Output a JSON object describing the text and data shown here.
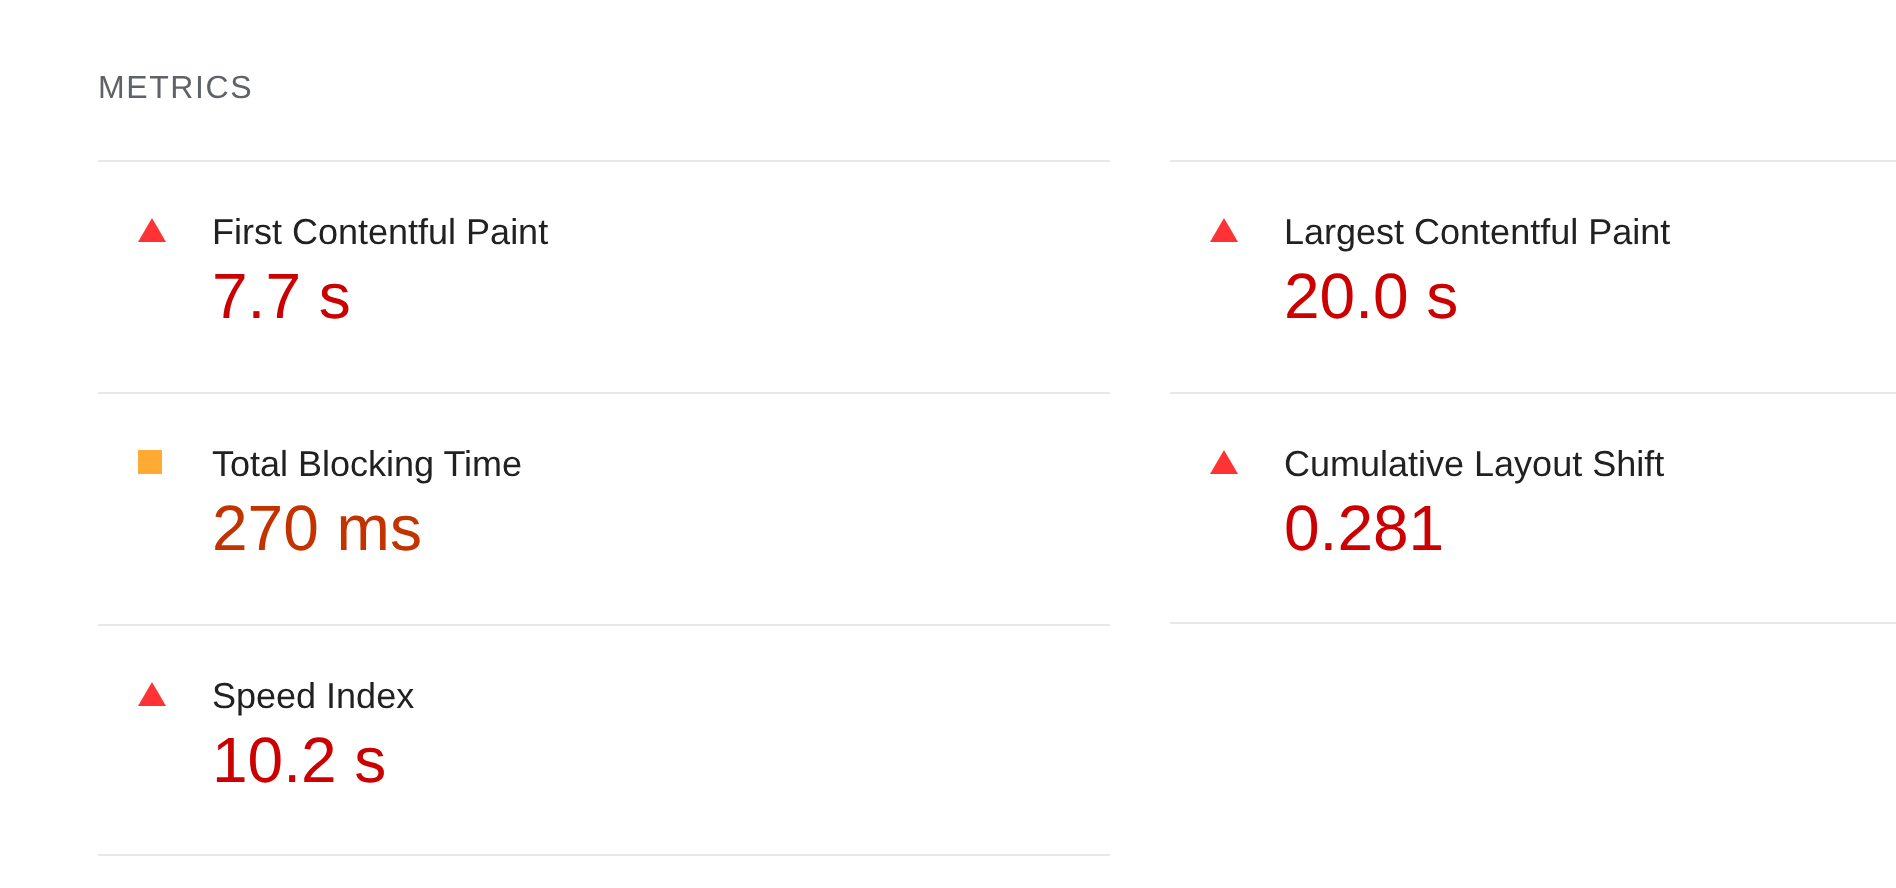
{
  "section_title": "METRICS",
  "metrics": [
    {
      "label": "First Contentful Paint",
      "value": "7.7 s",
      "kind": "fail"
    },
    {
      "label": "Largest Contentful Paint",
      "value": "20.0 s",
      "kind": "fail"
    },
    {
      "label": "Total Blocking Time",
      "value": "270 ms",
      "kind": "average"
    },
    {
      "label": "Cumulative Layout Shift",
      "value": "0.281",
      "kind": "fail"
    },
    {
      "label": "Speed Index",
      "value": "10.2 s",
      "kind": "fail"
    }
  ]
}
